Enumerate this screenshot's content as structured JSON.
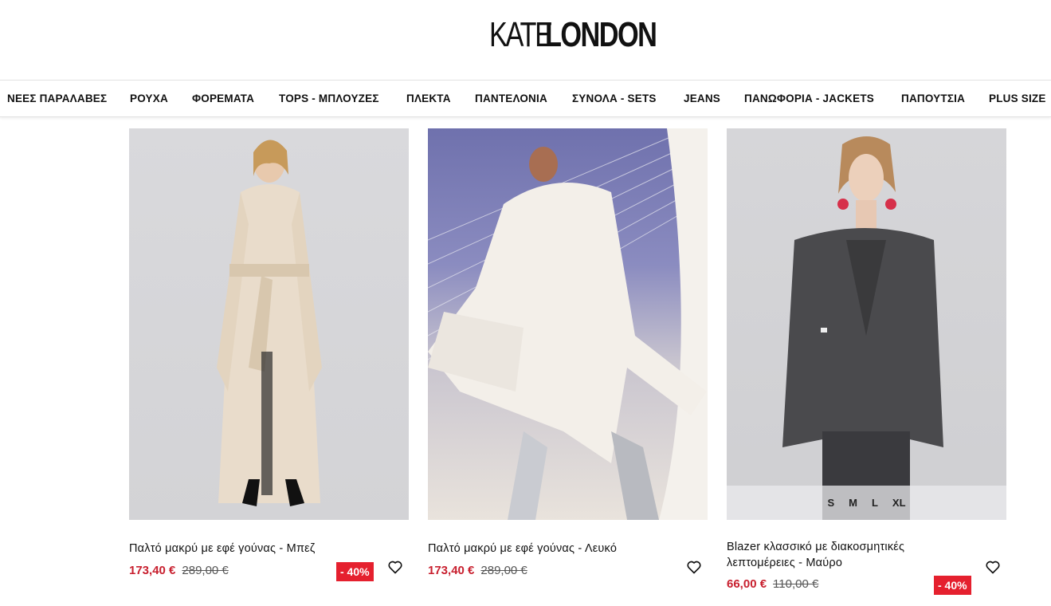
{
  "brand": {
    "logo_light": "KATE",
    "logo_bold": "LONDON"
  },
  "nav": [
    "ΝΕΕΣ ΠΑΡΑΛΑΒΕΣ",
    "ΡΟΥΧΑ",
    "ΦΟΡΕΜΑΤΑ",
    "TOPS - ΜΠΛΟΥΖΕΣ",
    "ΠΛΕΚΤΑ",
    "ΠΑΝΤΕΛΟΝΙΑ",
    "ΣΥΝΟΛΑ - SETS",
    "JEANS",
    "ΠΑΝΩΦΟΡΙΑ - JACKETS",
    "ΠΑΠΟΥΤΣΙΑ",
    "PLUS SIZE"
  ],
  "products": [
    {
      "title": "Παλτό μακρύ με εφέ γούνας - Μπεζ",
      "price": "173,40 €",
      "old_price": "289,00 €",
      "discount": "- 40%",
      "image": "beige-long-coat"
    },
    {
      "title": "Παλτό μακρύ με εφέ γούνας - Λευκό",
      "price": "173,40 €",
      "old_price": "289,00 €",
      "discount": "",
      "image": "white-long-coat"
    },
    {
      "title": "Blazer κλασσικό με διακοσμητικές λεπτομέρειες - Μαύρο",
      "price": "66,00 €",
      "old_price": "110,00 €",
      "discount": "- 40%",
      "image": "black-blazer",
      "sizes": [
        "S",
        "M",
        "L",
        "XL"
      ]
    }
  ],
  "colors": {
    "sale_red": "#e5202e",
    "price_red": "#c8202f"
  },
  "icons": {
    "wishlist": "heart-icon"
  }
}
